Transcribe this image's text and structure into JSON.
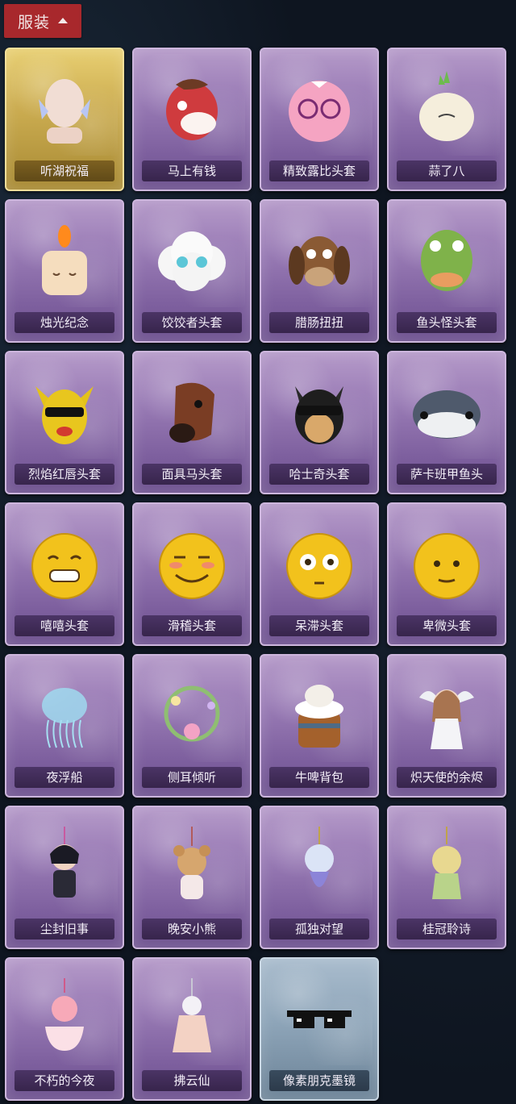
{
  "header": {
    "title": "服装"
  },
  "items": [
    {
      "name": "听湖祝福",
      "icon": "angel-head-icon",
      "rarity": "gold"
    },
    {
      "name": "马上有钱",
      "icon": "red-horse-head-icon",
      "rarity": "purple"
    },
    {
      "name": "精致露比头套",
      "icon": "pink-glasses-head-icon",
      "rarity": "purple"
    },
    {
      "name": "蒜了八",
      "icon": "garlic-head-icon",
      "rarity": "purple"
    },
    {
      "name": "烛光纪念",
      "icon": "candle-head-icon",
      "rarity": "purple"
    },
    {
      "name": "饺饺者头套",
      "icon": "cloud-head-icon",
      "rarity": "purple"
    },
    {
      "name": "腊肠扭扭",
      "icon": "dachshund-head-icon",
      "rarity": "purple"
    },
    {
      "name": "鱼头怪头套",
      "icon": "fish-head-icon",
      "rarity": "purple"
    },
    {
      "name": "烈焰红唇头套",
      "icon": "yellow-mouse-head-icon",
      "rarity": "purple"
    },
    {
      "name": "面具马头套",
      "icon": "horse-mask-icon",
      "rarity": "purple"
    },
    {
      "name": "哈士奇头套",
      "icon": "husky-head-icon",
      "rarity": "purple"
    },
    {
      "name": "萨卡班甲鱼头",
      "icon": "sacabambaspis-head-icon",
      "rarity": "purple"
    },
    {
      "name": "嘻嘻头套",
      "icon": "grin-emoji-head-icon",
      "rarity": "purple"
    },
    {
      "name": "滑稽头套",
      "icon": "smirk-emoji-head-icon",
      "rarity": "purple"
    },
    {
      "name": "呆滞头套",
      "icon": "dazed-emoji-head-icon",
      "rarity": "purple"
    },
    {
      "name": "卑微头套",
      "icon": "humble-emoji-head-icon",
      "rarity": "purple"
    },
    {
      "name": "夜浮船",
      "icon": "jellyfish-icon",
      "rarity": "purple"
    },
    {
      "name": "侧耳倾听",
      "icon": "flower-wreath-icon",
      "rarity": "purple"
    },
    {
      "name": "牛啤背包",
      "icon": "cow-beer-backpack-icon",
      "rarity": "purple"
    },
    {
      "name": "炽天使的余烬",
      "icon": "seraph-doll-icon",
      "rarity": "purple"
    },
    {
      "name": "尘封旧事",
      "icon": "prince-charm-icon",
      "rarity": "purple"
    },
    {
      "name": "晚安小熊",
      "icon": "bear-charm-icon",
      "rarity": "purple"
    },
    {
      "name": "孤独对望",
      "icon": "mermaid-charm-icon",
      "rarity": "purple"
    },
    {
      "name": "桂冠聆诗",
      "icon": "laurel-charm-icon",
      "rarity": "purple"
    },
    {
      "name": "不朽的今夜",
      "icon": "fox-teacup-charm-icon",
      "rarity": "purple"
    },
    {
      "name": "拂云仙",
      "icon": "fairy-charm-icon",
      "rarity": "purple"
    },
    {
      "name": "像素朋克墨镜",
      "icon": "pixel-sunglasses-icon",
      "rarity": "steel"
    }
  ]
}
